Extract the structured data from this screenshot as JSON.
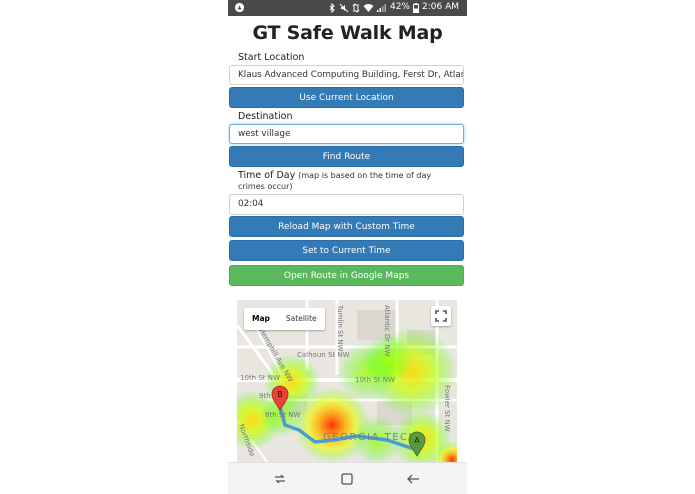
{
  "status": {
    "battery": "42%",
    "time": "2:06 AM"
  },
  "page": {
    "title": "GT Safe Walk Map"
  },
  "form": {
    "start_label": "Start Location",
    "start_value": "Klaus Advanced Computing Building, Ferst Dr, Atlanta",
    "use_location_button": "Use Current Location",
    "destination_label": "Destination",
    "destination_value": "west village",
    "find_route_button": "Find Route",
    "time_label": "Time of Day",
    "time_note": "(map is based on the time of day crimes occur)",
    "time_value": "02:04",
    "reload_button": "Reload Map with Custom Time",
    "set_time_button": "Set to Current Time",
    "open_gmaps_button": "Open Route in Google Maps"
  },
  "map": {
    "map_tab": "Map",
    "satellite_tab": "Satellite",
    "street_labels": [
      "Calhoun St NW",
      "10th St NW",
      "10th St NW",
      "8th St NW",
      "9th",
      "Fowler St NW",
      "Atlantic Dr NW",
      "Tumlin St NW",
      "Northside",
      "Hemphill Ave NW"
    ],
    "area_label": "GEORGIA TECH",
    "marker_a": "A",
    "marker_b": "B"
  },
  "colors": {
    "primary": "#337ab7",
    "success": "#5cb85c",
    "statusbar": "#4a4a4a"
  }
}
